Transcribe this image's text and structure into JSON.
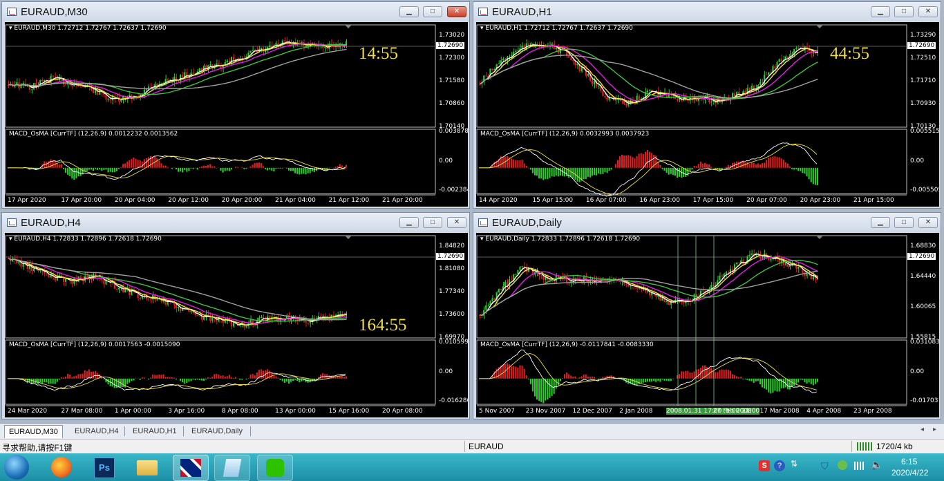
{
  "windows": [
    {
      "title": "EURAUD,M30",
      "header": "EURAUD,M30  1.72712 1.72767 1.72637 1.72690",
      "timer": "14:55",
      "price_tag": "1.72690",
      "price_levels": [
        "1.73020",
        "1.72300",
        "1.71580",
        "1.70860",
        "1.70140"
      ],
      "macd_label": "MACD_OsMA [CurrTF] (12,26,9) 0.0012232 0.0013562",
      "macd_levels": [
        "0.0038787",
        "0.00",
        "-0.002384"
      ],
      "time_labels": [
        "17 Apr 2020",
        "17 Apr 20:00",
        "20 Apr 04:00",
        "20 Apr 12:00",
        "20 Apr 20:00",
        "21 Apr 04:00",
        "21 Apr 12:00",
        "21 Apr 20:00"
      ]
    },
    {
      "title": "EURAUD,H1",
      "header": "EURAUD,H1  1.72712 1.72767 1.72637 1.72690",
      "timer": "44:55",
      "price_tag": "1.72690",
      "price_levels": [
        "1.73290",
        "1.72510",
        "1.71710",
        "1.70930",
        "1.70130"
      ],
      "macd_label": "MACD_OsMA [CurrTF] (12,26,9) 0.0032993 0.0037923",
      "macd_levels": [
        "0.0055155",
        "0.00",
        "-0.005505"
      ],
      "time_labels": [
        "14 Apr 2020",
        "15 Apr 15:00",
        "16 Apr 07:00",
        "16 Apr 23:00",
        "17 Apr 15:00",
        "20 Apr 07:00",
        "20 Apr 23:00",
        "21 Apr 15:00"
      ]
    },
    {
      "title": "EURAUD,H4",
      "header": "EURAUD,H4  1.72833 1.72896 1.72618 1.72690",
      "timer": "164:55",
      "price_tag": "1.72690",
      "price_levels": [
        "1.84820",
        "1.81080",
        "1.77340",
        "1.73600",
        "1.69970"
      ],
      "macd_label": "MACD_OsMA [CurrTF] (12,26,9) 0.0017563 -0.0015090",
      "macd_levels": [
        "0.0105993",
        "0.00",
        "-0.016286"
      ],
      "time_labels": [
        "24 Mar 2020",
        "27 Mar 08:00",
        "1 Apr 00:00",
        "3 Apr 16:00",
        "8 Apr 08:00",
        "13 Apr 00:00",
        "15 Apr 16:00",
        "20 Apr 08:00"
      ]
    },
    {
      "title": "EURAUD,Daily",
      "header": "EURAUD,Daily  1.72833 1.72896 1.72618 1.72690",
      "timer": "",
      "price_tag": "1.72690",
      "price_levels": [
        "1.68830",
        "1.64440",
        "1.60065",
        "1.55815"
      ],
      "macd_label": "MACD_OsMA [CurrTF] (12,26,9) -0.0117841 -0.0083330",
      "macd_levels": [
        "0.0310834",
        "0.00",
        "-0.017031"
      ],
      "time_labels": [
        "5 Nov 2007",
        "23 Nov 2007",
        "12 Dec 2007",
        "2 Jan 2008",
        "2008.01.31 17:00 :5:00  21:00",
        "27 Feb 2008",
        "17 Mar 2008",
        "4 Apr 2008",
        "23 Apr 2008"
      ]
    }
  ],
  "tabs": [
    "EURAUD,M30",
    "EURAUD,H4",
    "EURAUD,H1",
    "EURAUD,Daily"
  ],
  "status": {
    "help": "寻求帮助,请按F1键",
    "symbol": "EURAUD",
    "traffic": "1720/4 kb"
  },
  "taskbar": {
    "time": "6:15",
    "date": "2020/4/22"
  },
  "colors": {
    "bull": "#2ecc2e",
    "bear": "#e02020",
    "ma_white": "#ffffff",
    "ma_yellow": "#f0e040",
    "ma_magenta": "#e020e0",
    "ma_green": "#40c040",
    "ma_gray": "#a0a0a0",
    "timer": "#f0dc46"
  }
}
